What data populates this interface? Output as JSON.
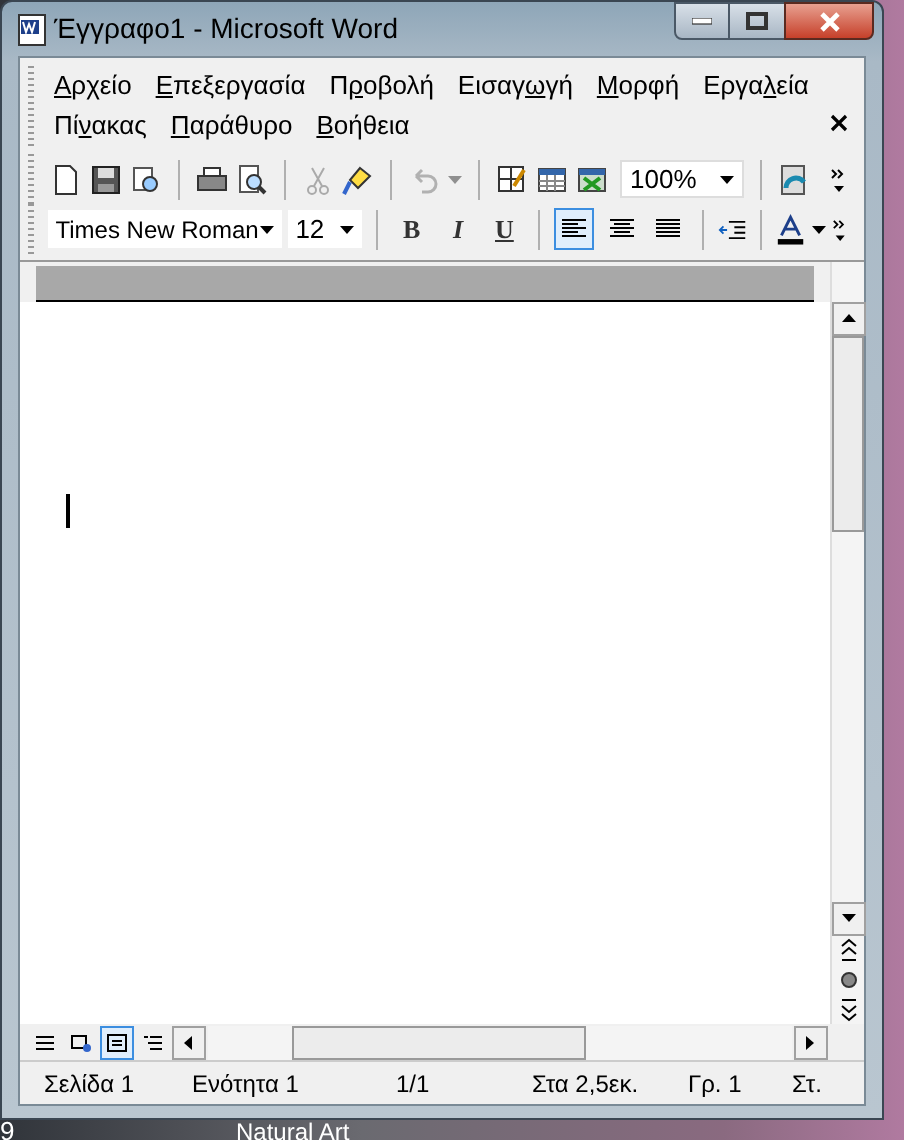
{
  "window": {
    "title": "Έγγραφο1 - Microsoft Word"
  },
  "menu": [
    {
      "key": "Α",
      "post": "ρχείο"
    },
    {
      "key": "Ε",
      "post": "πεξεργασία"
    },
    {
      "pre": "Π",
      "key": "ρ",
      "post": "οβολή"
    },
    {
      "pre": "Εισαγ",
      "key": "ω",
      "post": "γή"
    },
    {
      "key": "Μ",
      "post": "ορφή"
    },
    {
      "pre": "Εργα",
      "key": "λ",
      "post": "εία"
    },
    {
      "pre": "Πί",
      "key": "ν",
      "post": "ακας"
    },
    {
      "key": "Π",
      "post": "αράθυρο"
    },
    {
      "key": "Β",
      "post": "οήθεια"
    }
  ],
  "standard_toolbar": {
    "buttons": [
      {
        "kind": "new",
        "disabled": false
      },
      {
        "kind": "save",
        "disabled": false
      },
      {
        "kind": "permission",
        "disabled": false
      },
      {
        "kind": "sep"
      },
      {
        "kind": "print",
        "disabled": false
      },
      {
        "kind": "preview",
        "disabled": false
      },
      {
        "kind": "sep"
      },
      {
        "kind": "cut",
        "disabled": true
      },
      {
        "kind": "painter",
        "disabled": false
      },
      {
        "kind": "sep"
      },
      {
        "kind": "undo",
        "disabled": true
      },
      {
        "kind": "sep"
      },
      {
        "kind": "tables",
        "disabled": false
      },
      {
        "kind": "table",
        "disabled": false
      },
      {
        "kind": "sheet",
        "disabled": false
      }
    ],
    "zoom": "100%"
  },
  "format_toolbar": {
    "font": "Times New Roman",
    "size": "12",
    "buttons": [
      {
        "kind": "bold",
        "label": "B",
        "selected": false
      },
      {
        "kind": "italic",
        "label": "I",
        "selected": false
      },
      {
        "kind": "underline",
        "label": "U",
        "selected": false
      },
      {
        "kind": "left",
        "selected": true
      },
      {
        "kind": "center",
        "selected": false
      },
      {
        "kind": "justify",
        "selected": false
      }
    ]
  },
  "view_buttons": [
    {
      "kind": "normal",
      "selected": false
    },
    {
      "kind": "web",
      "selected": false
    },
    {
      "kind": "print",
      "selected": true
    },
    {
      "kind": "outline",
      "selected": false
    }
  ],
  "status_bar": [
    "Σελίδα 1",
    "Ενότητα 1",
    "1/1",
    "Στα 2,5εκ.",
    "Γρ. 1",
    "Στ."
  ],
  "desktop": {
    "labels": [
      "9",
      "Natural Art"
    ]
  }
}
